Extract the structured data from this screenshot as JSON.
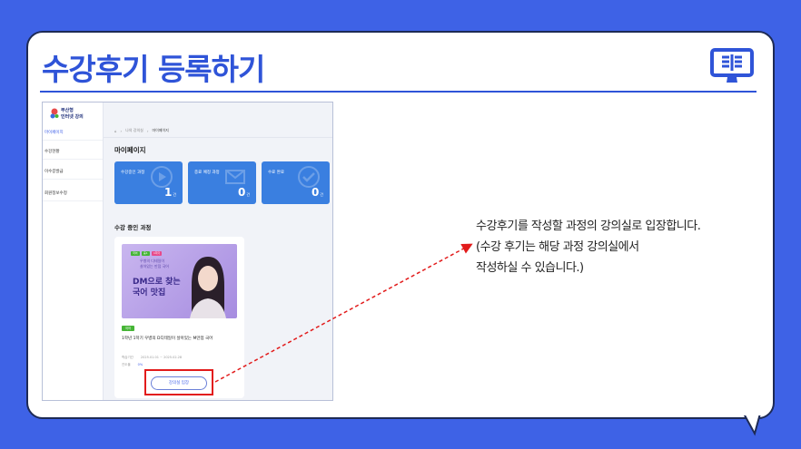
{
  "header": {
    "title": "수강후기 등록하기",
    "icon": "book-icon",
    "accent": "#2f54d8"
  },
  "screenshot": {
    "logo": {
      "line1": "부산형",
      "line2": "인터넷 강의"
    },
    "sidebar": [
      {
        "label": "마이페이지",
        "active": true
      },
      {
        "label": "수강현황",
        "active": false
      },
      {
        "label": "이수증발급",
        "active": false
      },
      {
        "label": "회원정보수정",
        "active": false
      }
    ],
    "breadcrumb": {
      "home": "⌂",
      "item1": "나의 강의실",
      "current": "마이페이지"
    },
    "page_title": "마이페이지",
    "stats": [
      {
        "label": "수강중인 과정",
        "value": "1",
        "unit": "건"
      },
      {
        "label": "종료 예정 과정",
        "value": "0",
        "unit": "건"
      },
      {
        "label": "수료 완료",
        "value": "0",
        "unit": "건"
      }
    ],
    "section_title": "수강 중인 과정",
    "course": {
      "thumb": {
        "tags": [
          "국어",
          "중1",
          "1학기"
        ],
        "sub1": "우병의 디테일이",
        "sub2": "살아있는 만점 국어",
        "big1": "DM으로 찾는",
        "big2": "국어 맛집"
      },
      "badge": "국어",
      "name": "1학년 1학기 우병의 D디테일이 살아있는 M만점 국어",
      "period_label": "학습기간",
      "period": "2025.01.01 ~ 2025.02.28",
      "progress_label": "진도율",
      "progress": "0%",
      "button": "강의실 입장"
    }
  },
  "description": {
    "line1": "수강후기를 작성할 과정의 강의실로 입장합니다.",
    "line2": "(수강 후기는 해당 과정 강의실에서",
    "line3": "작성하실 수 있습니다.)"
  }
}
